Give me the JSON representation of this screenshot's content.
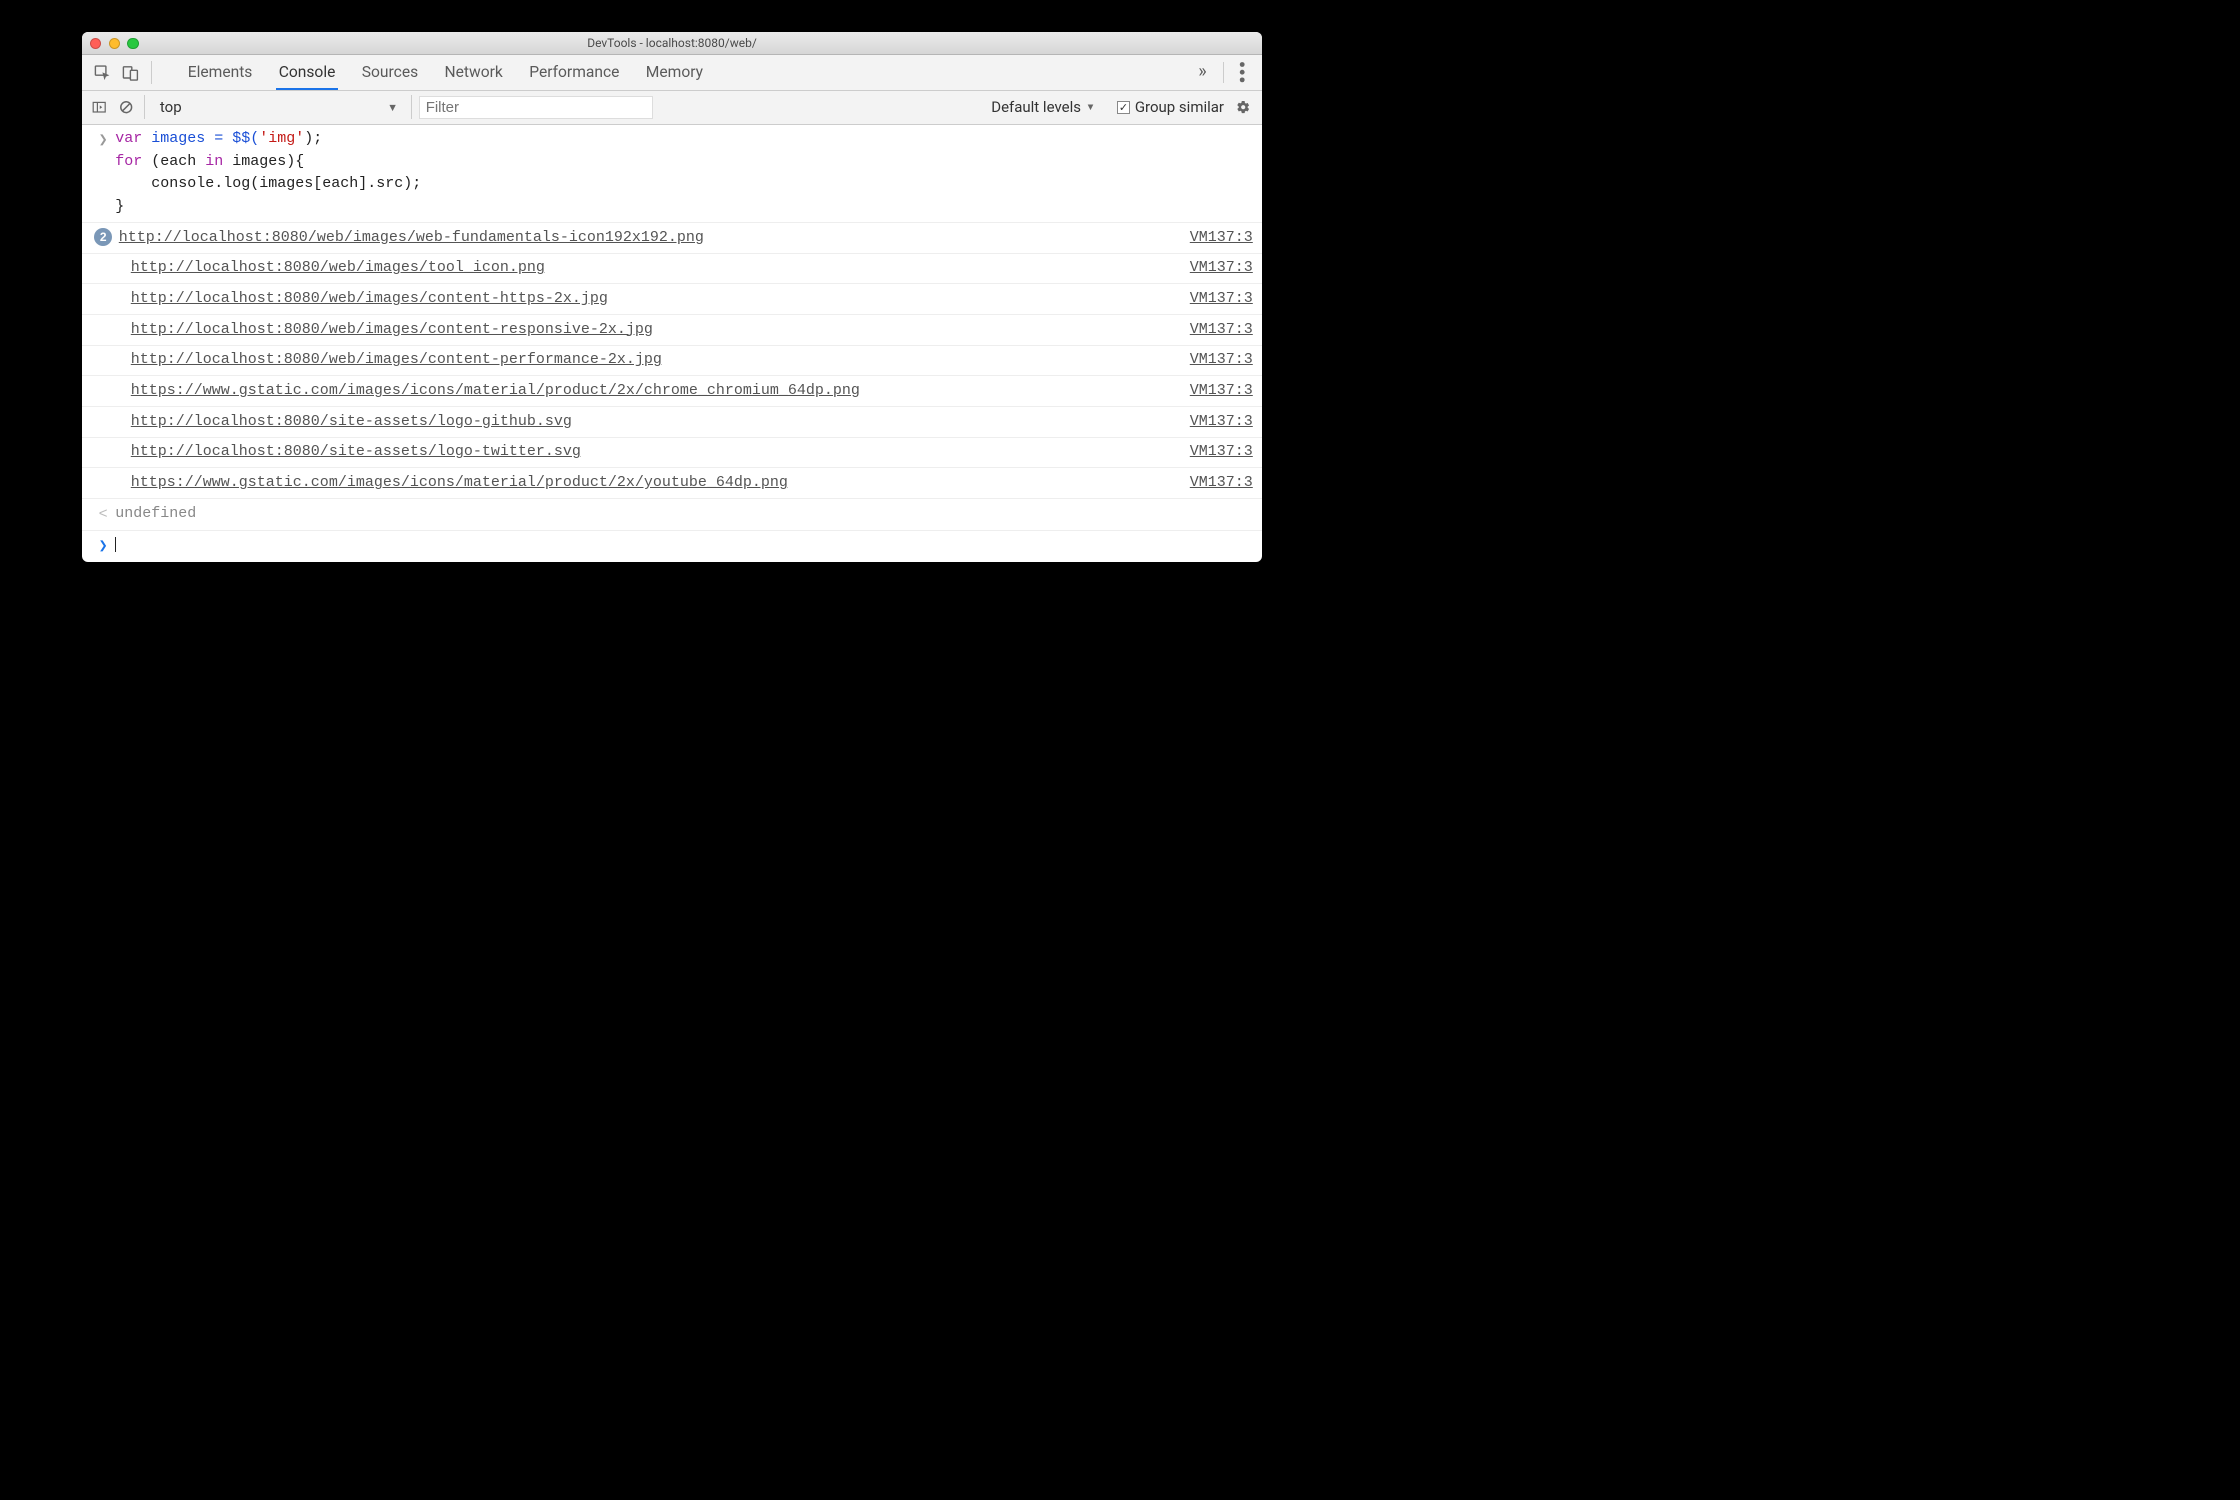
{
  "window": {
    "title": "DevTools - localhost:8080/web/"
  },
  "tabs": {
    "items": [
      "Elements",
      "Console",
      "Sources",
      "Network",
      "Performance",
      "Memory"
    ],
    "active": "Console",
    "overflow": "»"
  },
  "filter": {
    "context": "top",
    "filter_placeholder": "Filter",
    "levels_label": "Default levels",
    "group_label": "Group similar",
    "group_checked": true
  },
  "code": {
    "l1a": "var",
    "l1b": " images = $$(",
    "l1c": "'img'",
    "l1d": ");",
    "l2a": "for",
    "l2b": " (each ",
    "l2c": "in",
    "l2d": " images){",
    "l3": "    console.log(images[each].src);",
    "l4": "}"
  },
  "logs": [
    {
      "count": "2",
      "text": "http://localhost:8080/web/images/web-fundamentals-icon192x192.png",
      "src": "VM137:3"
    },
    {
      "text": "http://localhost:8080/web/images/tool_icon.png",
      "src": "VM137:3"
    },
    {
      "text": "http://localhost:8080/web/images/content-https-2x.jpg",
      "src": "VM137:3"
    },
    {
      "text": "http://localhost:8080/web/images/content-responsive-2x.jpg",
      "src": "VM137:3"
    },
    {
      "text": "http://localhost:8080/web/images/content-performance-2x.jpg",
      "src": "VM137:3"
    },
    {
      "text": "https://www.gstatic.com/images/icons/material/product/2x/chrome_chromium_64dp.png",
      "src": "VM137:3"
    },
    {
      "text": "http://localhost:8080/site-assets/logo-github.svg",
      "src": "VM137:3"
    },
    {
      "text": "http://localhost:8080/site-assets/logo-twitter.svg",
      "src": "VM137:3"
    },
    {
      "text": "https://www.gstatic.com/images/icons/material/product/2x/youtube_64dp.png",
      "src": "VM137:3"
    }
  ],
  "result": {
    "text": "undefined"
  }
}
